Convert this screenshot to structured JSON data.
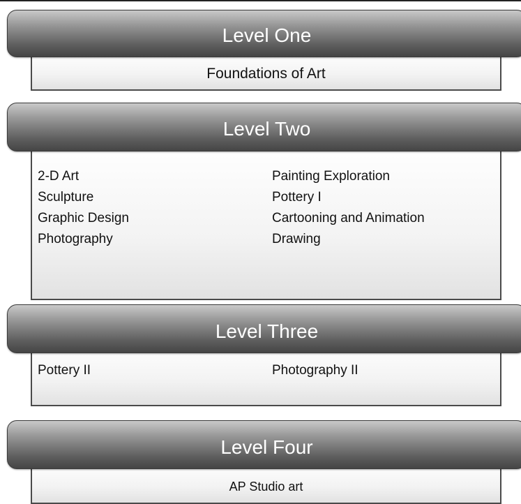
{
  "levels": [
    {
      "title": "Level One",
      "courses": [
        "Foundations of Art"
      ]
    },
    {
      "title": "Level Two",
      "courses_left": [
        "2-D Art",
        "Sculpture",
        "Graphic Design",
        "Photography"
      ],
      "courses_right": [
        "Painting Exploration",
        "Pottery I",
        "Cartooning and Animation",
        "Drawing"
      ]
    },
    {
      "title": "Level Three",
      "courses_left": [
        "Pottery II"
      ],
      "courses_right": [
        "Photography II"
      ]
    },
    {
      "title": "Level Four",
      "courses": [
        "AP Studio art"
      ]
    }
  ]
}
